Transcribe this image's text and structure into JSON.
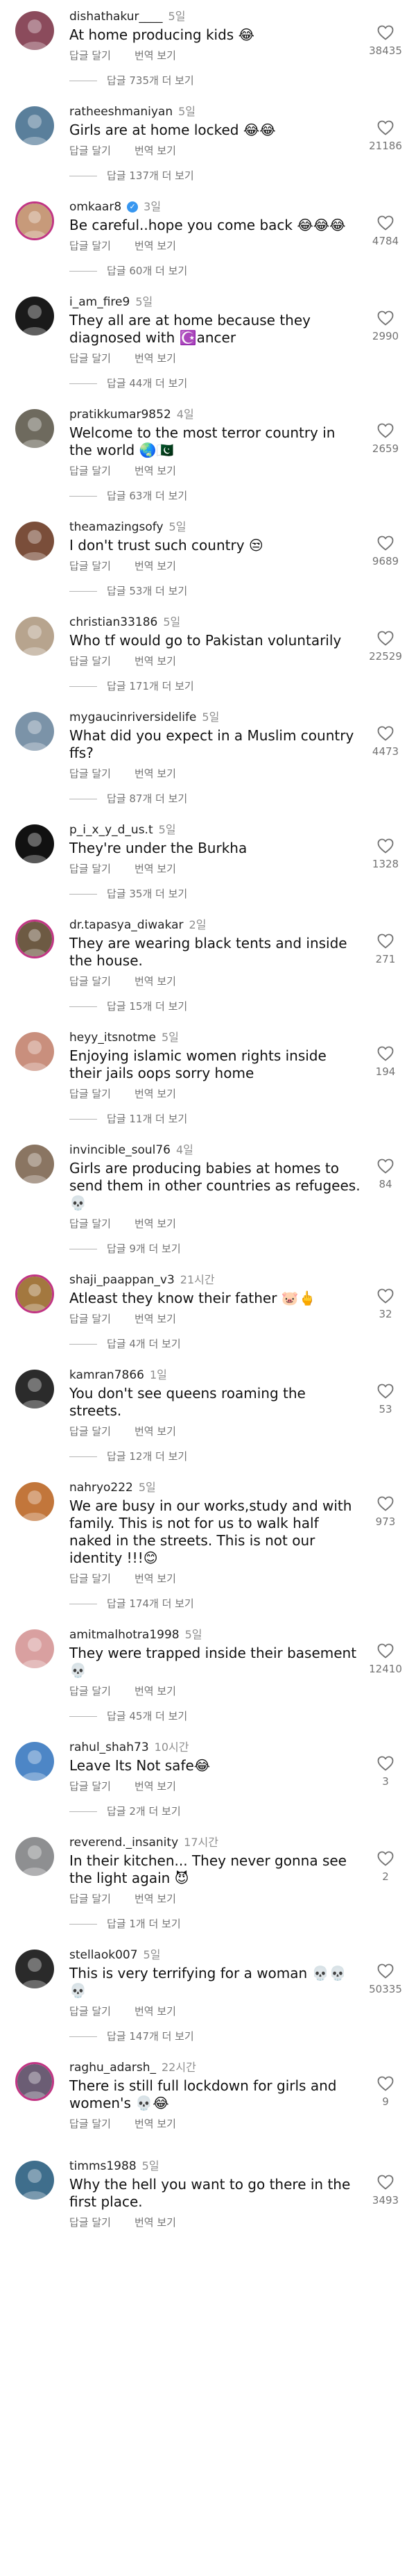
{
  "labels": {
    "reply": "답글 달기",
    "translate": "번역 보기"
  },
  "comments": [
    {
      "user": "dishathakur____",
      "time": "5일",
      "text": "At home producing kids 😂",
      "likes": "38435",
      "replies": "답글 735개 더 보기",
      "avatar": "#8b4b5c"
    },
    {
      "user": "ratheeshmaniyan",
      "time": "5일",
      "text": "Girls are at home locked 😂😂",
      "likes": "21186",
      "replies": "답글 137개 더 보기",
      "avatar": "#5a7f9b"
    },
    {
      "user": "omkaar8",
      "time": "3일",
      "text": "Be careful..hope you come back 😂😂😂",
      "likes": "4784",
      "replies": "답글 60개 더 보기",
      "avatar": "#c79a7a",
      "verified": true,
      "ring": true
    },
    {
      "user": "i_am_fire9",
      "time": "5일",
      "text": "They all are at home because they diagnosed with ☪️ancer",
      "likes": "2990",
      "replies": "답글 44개 더 보기",
      "avatar": "#1a1a1a"
    },
    {
      "user": "pratikkumar9852",
      "time": "4일",
      "text": "Welcome to the most terror country in the world 🌏🇵🇰",
      "likes": "2659",
      "replies": "답글 63개 더 보기",
      "avatar": "#6e6a5e"
    },
    {
      "user": "theamazingsofy",
      "time": "5일",
      "text": "I don't trust such country 😒",
      "likes": "9689",
      "replies": "답글 53개 더 보기",
      "avatar": "#7a4e3a"
    },
    {
      "user": "christian33186",
      "time": "5일",
      "text": "Who tf would go to Pakistan voluntarily",
      "likes": "22529",
      "replies": "답글 171개 더 보기",
      "avatar": "#b7a48e"
    },
    {
      "user": "mygaucinriversidelife",
      "time": "5일",
      "text": "What did you expect in a Muslim country ffs?",
      "likes": "4473",
      "replies": "답글 87개 더 보기",
      "avatar": "#7b93a8"
    },
    {
      "user": "p_i_x_y_d_us.t",
      "time": "5일",
      "text": "They're under the Burkha",
      "likes": "1328",
      "replies": "답글 35개 더 보기",
      "avatar": "#111111"
    },
    {
      "user": "dr.tapasya_diwakar",
      "time": "2일",
      "text": "They are wearing black tents and inside the house.",
      "likes": "271",
      "replies": "답글 15개 더 보기",
      "avatar": "#6d5a43",
      "ring": true
    },
    {
      "user": "heyy_itsnotme",
      "time": "5일",
      "text": "Enjoying islamic women rights inside their jails oops sorry home",
      "likes": "194",
      "replies": "답글 11개 더 보기",
      "avatar": "#c98f7d"
    },
    {
      "user": "invincible_soul76",
      "time": "4일",
      "text": "Girls are producing babies at homes to send them in other countries as refugees. 💀",
      "likes": "84",
      "replies": "답글 9개 더 보기",
      "avatar": "#8a7562"
    },
    {
      "user": "shaji_paappan_v3",
      "time": "21시간",
      "text": "Atleast they know their father 🐷🖕",
      "likes": "32",
      "replies": "답글 4개 더 보기",
      "avatar": "#a3783f",
      "ring": true
    },
    {
      "user": "kamran7866",
      "time": "1일",
      "text": "You don't see queens roaming the streets.",
      "likes": "53",
      "replies": "답글 12개 더 보기",
      "avatar": "#2b2b2b"
    },
    {
      "user": "nahryo222",
      "time": "5일",
      "text": "We are busy in our works,study and with family. This is not for us to walk half naked in the streets. This is not our identity !!!😊",
      "likes": "973",
      "replies": "답글 174개 더 보기",
      "avatar": "#c2763b"
    },
    {
      "user": "amitmalhotra1998",
      "time": "5일",
      "text": "They were trapped inside their basement 💀",
      "likes": "12410",
      "replies": "답글 45개 더 보기",
      "avatar": "#d9a0a0"
    },
    {
      "user": "rahul_shah73",
      "time": "10시간",
      "text": "Leave Its Not safe😂",
      "likes": "3",
      "replies": "답글 2개 더 보기",
      "avatar": "#4d86c6"
    },
    {
      "user": "reverend._insanity",
      "time": "17시간",
      "text": "In their kitchen... They never gonna see the light again 😈",
      "likes": "2",
      "replies": "답글 1개 더 보기",
      "avatar": "#8e8f91"
    },
    {
      "user": "stellaok007",
      "time": "5일",
      "text": "This is very terrifying for a woman 💀💀💀",
      "likes": "50335",
      "replies": "답글 147개 더 보기",
      "avatar": "#2a2a2a"
    },
    {
      "user": "raghu_adarsh_",
      "time": "22시간",
      "text": "There is still full lockdown for girls and women's 💀😂",
      "likes": "9",
      "replies": "",
      "avatar": "#6b5d74",
      "ring": true
    },
    {
      "user": "timms1988",
      "time": "5일",
      "text": "Why the hell you want to go there in the first place.",
      "likes": "3493",
      "replies": "",
      "avatar": "#3f6e8c"
    }
  ]
}
